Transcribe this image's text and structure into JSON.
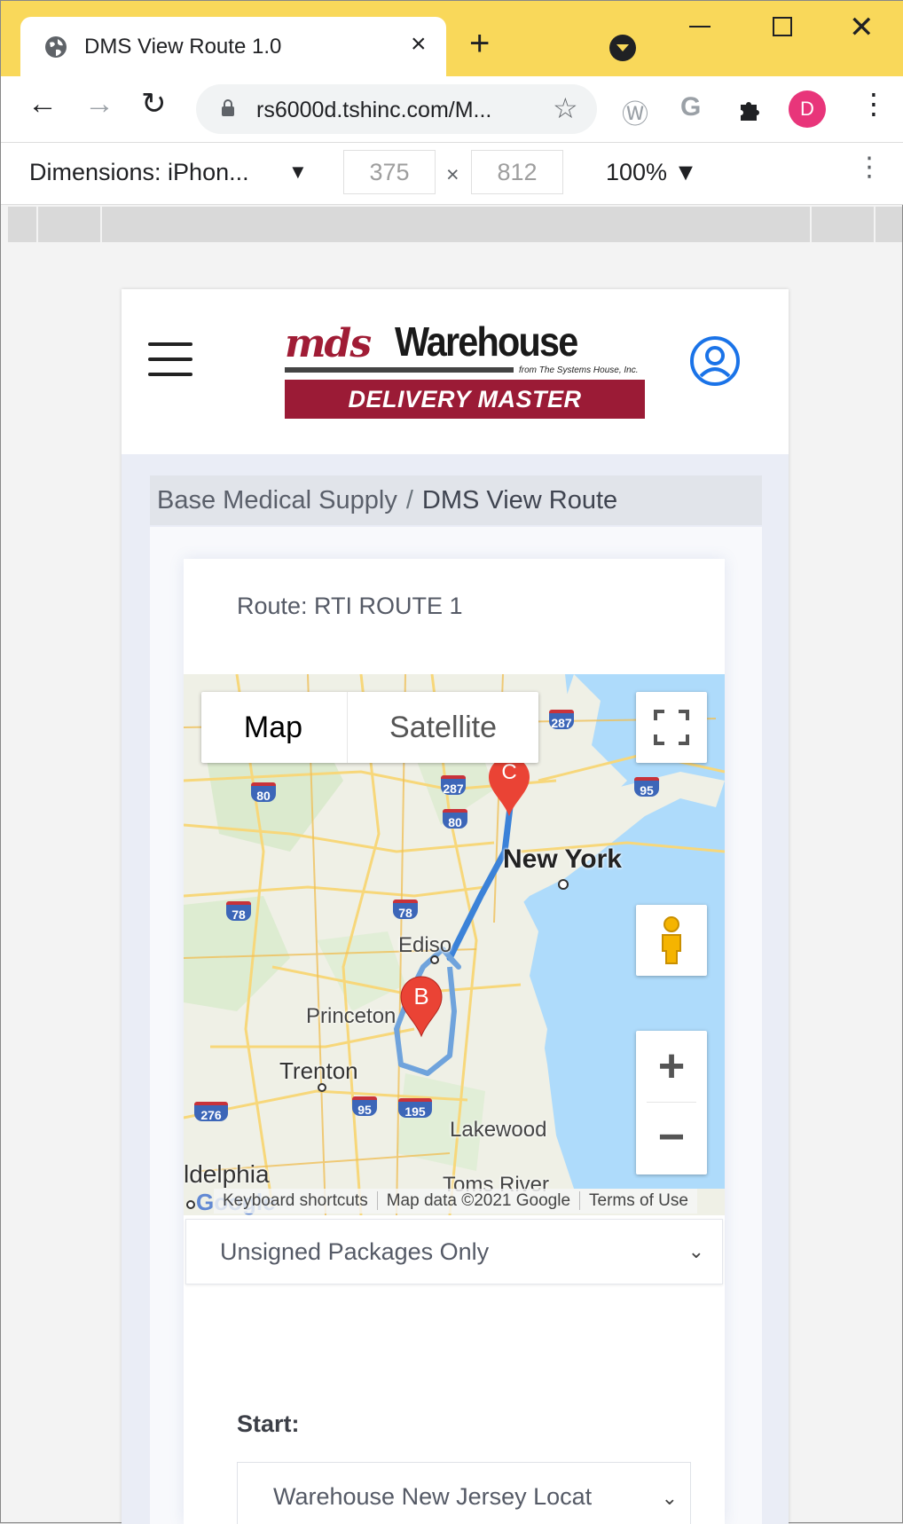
{
  "browser": {
    "tab_title": "DMS View Route 1.0",
    "tab_close": "×",
    "new_tab": "+",
    "url": "rs6000d.tshinc.com/M...",
    "profile_initial": "D",
    "icons": [
      "globe-icon",
      "back-arrow-icon",
      "forward-arrow-icon",
      "reload-icon",
      "lock-icon",
      "star-icon",
      "wordpress-icon",
      "google-icon",
      "puzzle-extension-icon",
      "more-vert-icon"
    ]
  },
  "devtools": {
    "dimensions_label": "Dimensions: iPhon...",
    "width": "375",
    "height": "812",
    "times": "×",
    "zoom": "100%"
  },
  "app": {
    "logo": {
      "mds": "mds",
      "warehouse": "Warehouse",
      "byline": "from The Systems House, Inc.",
      "band": "DELIVERY MASTER"
    },
    "breadcrumb": {
      "parent": "Base Medical Supply",
      "separator": "/",
      "current": "DMS View Route"
    },
    "route_label": "Route: RTI ROUTE 1",
    "map": {
      "type_map": "Map",
      "type_satellite": "Satellite",
      "markers": [
        "B",
        "C"
      ],
      "places": [
        "New York",
        "Ediso",
        "Princeton",
        "Trenton",
        "Lakewood",
        "Toms River",
        "ldelphia"
      ],
      "routes": [
        "287",
        "80",
        "95",
        "78",
        "276",
        "195"
      ],
      "google": "Google",
      "footer": [
        "Keyboard shortcuts",
        "Map data ©2021 Google",
        "Terms of Use"
      ],
      "zoom_in": "+",
      "zoom_out": "−",
      "route_color": "#3b82d8"
    },
    "package_filter": "Unsigned Packages Only",
    "start_label": "Start:",
    "start_value": "Warehouse New Jersey Locat"
  },
  "colors": {
    "tab_strip": "#f9d85a",
    "brand": "#9b1b36",
    "accent": "#1a73e8",
    "avatar": "#e8357a"
  }
}
